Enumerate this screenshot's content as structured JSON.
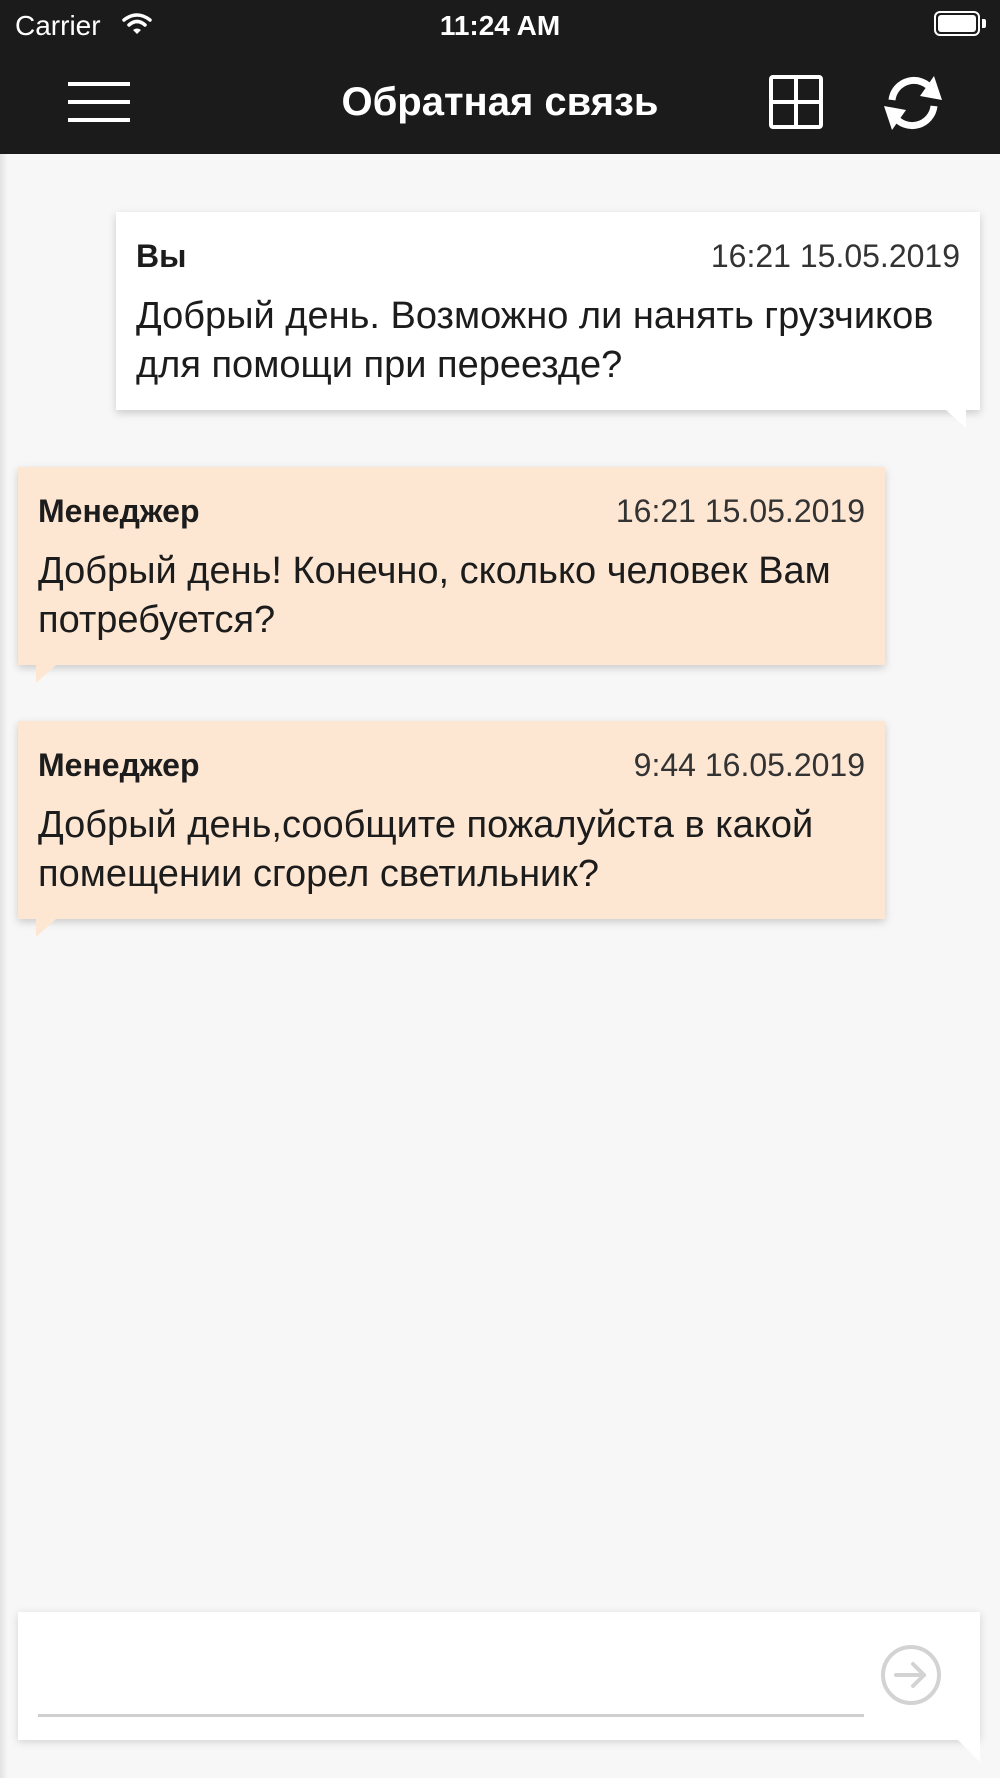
{
  "status_bar": {
    "carrier": "Carrier",
    "time": "11:24 AM",
    "wifi_icon": "wifi-icon",
    "battery_icon": "battery-icon"
  },
  "nav": {
    "title": "Обратная связь",
    "menu_icon": "hamburger-menu-icon",
    "grid_icon": "grid-icon",
    "refresh_icon": "refresh-icon"
  },
  "messages": [
    {
      "sender": "Вы",
      "time": "16:21 15.05.2019",
      "text": "Добрый день. Возможно ли нанять грузчиков для помощи при переезде?",
      "direction": "outgoing",
      "bubble_color": "#ffffff"
    },
    {
      "sender": "Менеджер",
      "time": "16:21 15.05.2019",
      "text": "Добрый день! Конечно, сколько человек Вам потребуется?",
      "direction": "incoming",
      "bubble_color": "#fde7d3"
    },
    {
      "sender": "Менеджер",
      "time": "9:44 16.05.2019",
      "text": "Добрый день,сообщите пожалуйста в какой помещении сгорел светильник?",
      "direction": "incoming",
      "bubble_color": "#fde7d3"
    }
  ],
  "composer": {
    "value": "",
    "placeholder": "",
    "send_icon": "send-arrow-icon"
  },
  "colors": {
    "header_bg": "#1b1b1b",
    "page_bg": "#f7f7f7",
    "incoming_bubble": "#fde7d3",
    "outgoing_bubble": "#ffffff"
  }
}
